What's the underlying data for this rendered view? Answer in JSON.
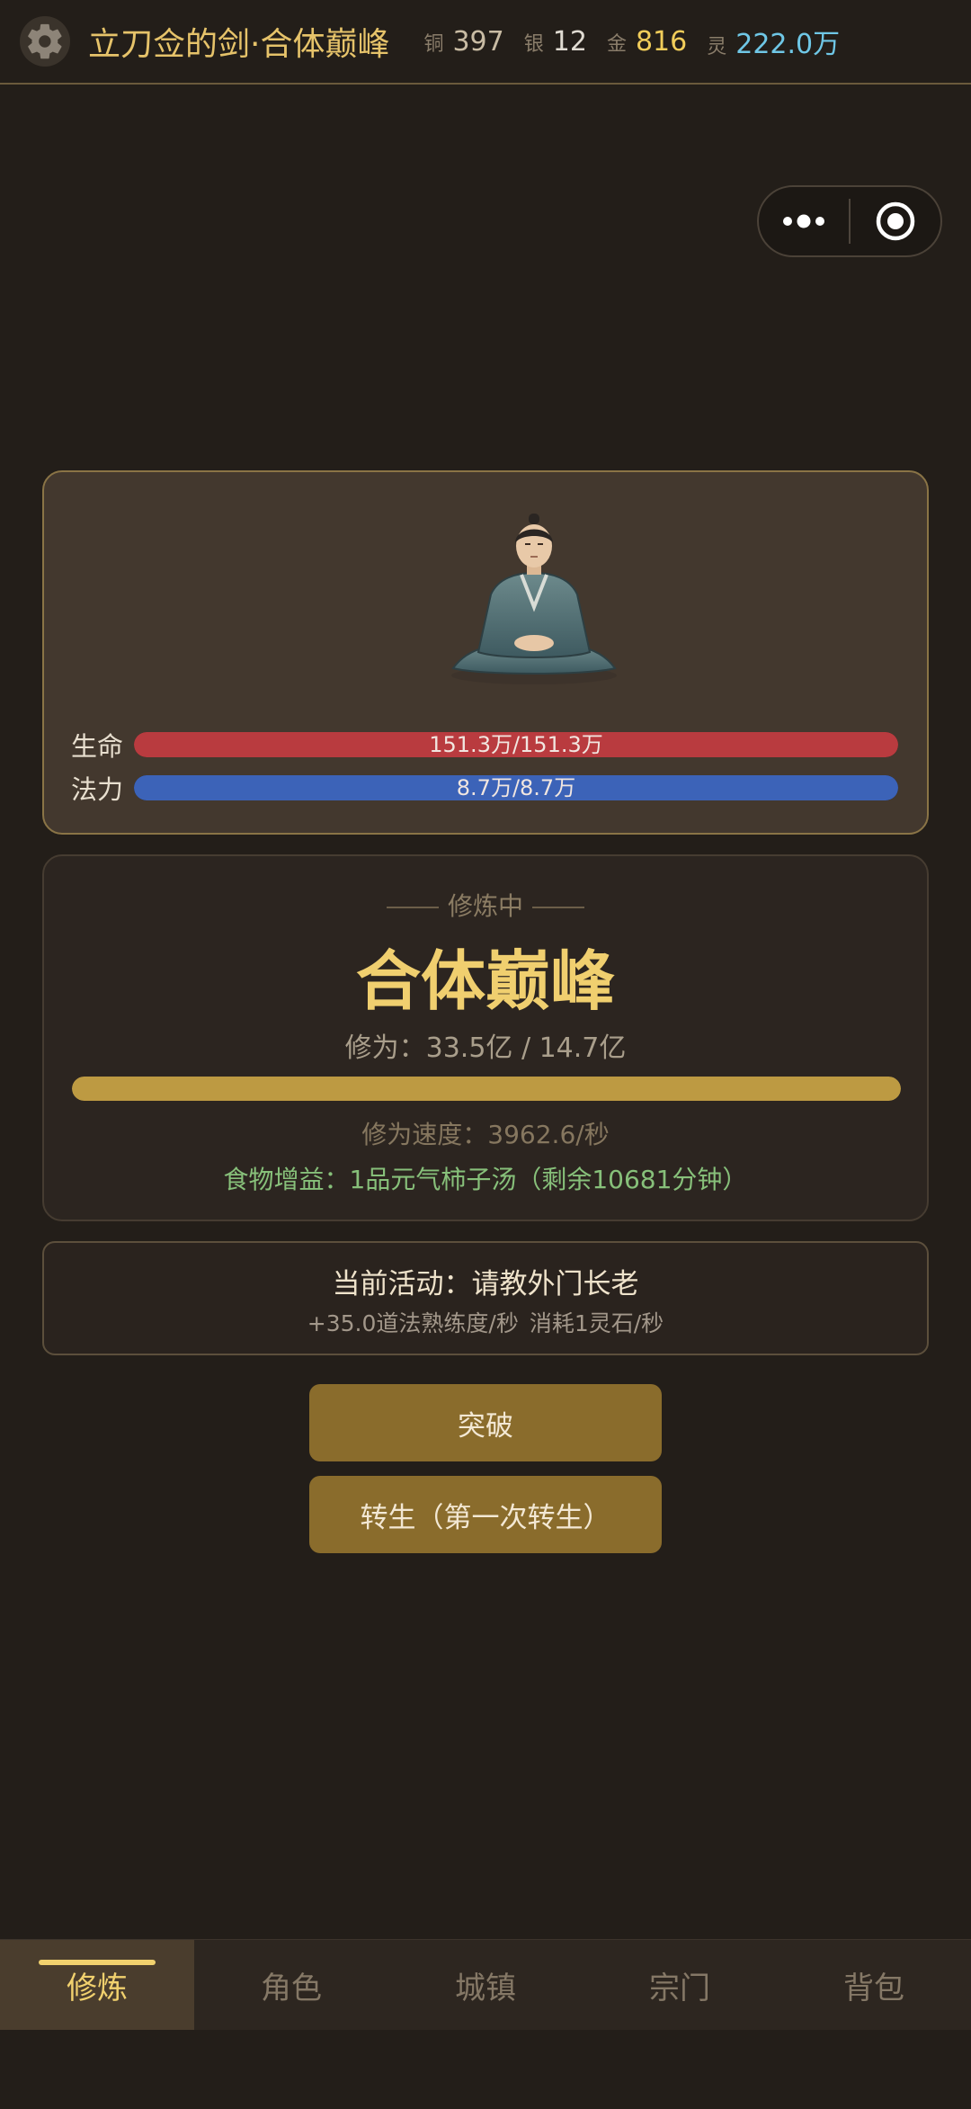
{
  "header": {
    "title": "立刀佥的剑·合体巅峰",
    "currencies": [
      {
        "label": "铜",
        "value": "397",
        "color": "#c9bca4"
      },
      {
        "label": "银",
        "value": "12",
        "color": "#e0dbd2"
      },
      {
        "label": "金",
        "value": "816",
        "color": "#f1cd5a"
      },
      {
        "label": "灵",
        "value": "222.0万",
        "color": "#6fc7e6"
      }
    ]
  },
  "stats": {
    "hp": {
      "label": "生命",
      "text": "151.3万/151.3万",
      "fraction": 1.0
    },
    "mp": {
      "label": "法力",
      "text": "8.7万/8.7万",
      "fraction": 1.0
    }
  },
  "cultivation": {
    "status": "修炼中",
    "realm": "合体巅峰",
    "progress_text": "修为：33.5亿 / 14.7亿",
    "progress_fraction": 1.0,
    "speed_text": "修为速度：3962.6/秒",
    "food_text": "食物增益：1品元气柿子汤（剩余10681分钟）"
  },
  "activity": {
    "title": "当前活动：请教外门长老",
    "gain": "+35.0道法熟练度/秒",
    "cost": "消耗1灵石/秒"
  },
  "buttons": {
    "breakthrough": "突破",
    "rebirth": "转生（第一次转生）"
  },
  "nav": {
    "items": [
      "修炼",
      "角色",
      "城镇",
      "宗门",
      "背包"
    ],
    "active_index": 0
  },
  "colors": {
    "hp_bar": "#b93b3f",
    "mp_bar": "#3c63b8",
    "progress_bar": "#bd9a42",
    "accent_gold": "#f0cf6f",
    "food_green": "#87c07a"
  }
}
